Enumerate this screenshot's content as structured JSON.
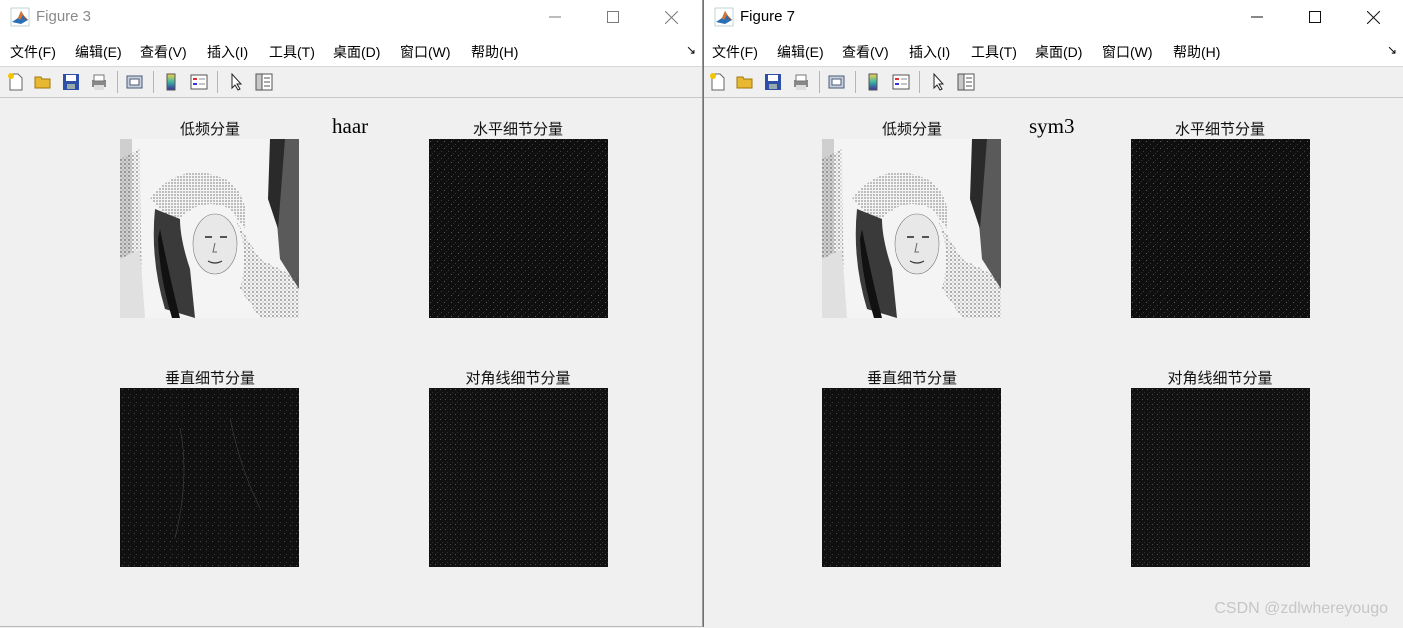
{
  "figures": [
    {
      "title": "Figure 3",
      "active": false,
      "wavelet": "haar",
      "menu": [
        "文件(F)",
        "编辑(E)",
        "查看(V)",
        "插入(I)",
        "工具(T)",
        "桌面(D)",
        "窗口(W)",
        "帮助(H)"
      ],
      "plots": {
        "low": "低频分量",
        "horizontal": "水平细节分量",
        "vertical": "垂直细节分量",
        "diagonal": "对角线细节分量"
      }
    },
    {
      "title": "Figure 7",
      "active": true,
      "wavelet": "sym3",
      "menu": [
        "文件(F)",
        "编辑(E)",
        "查看(V)",
        "插入(I)",
        "工具(T)",
        "桌面(D)",
        "窗口(W)",
        "帮助(H)"
      ],
      "plots": {
        "low": "低频分量",
        "horizontal": "水平细节分量",
        "vertical": "垂直细节分量",
        "diagonal": "对角线细节分量"
      }
    }
  ],
  "toolbar_icons": [
    "new-figure-icon",
    "open-file-icon",
    "save-icon",
    "print-icon",
    "print-preview-icon",
    "colorbar-icon",
    "legend-icon",
    "pointer-icon",
    "property-inspector-icon"
  ],
  "window_controls": [
    "minimize-icon",
    "maximize-icon",
    "close-icon"
  ],
  "watermark": "CSDN @zdlwhereyougo",
  "colors": {
    "titlebar": "#ffffff",
    "background": "#f0f0f0",
    "detail_background": "#101010"
  }
}
